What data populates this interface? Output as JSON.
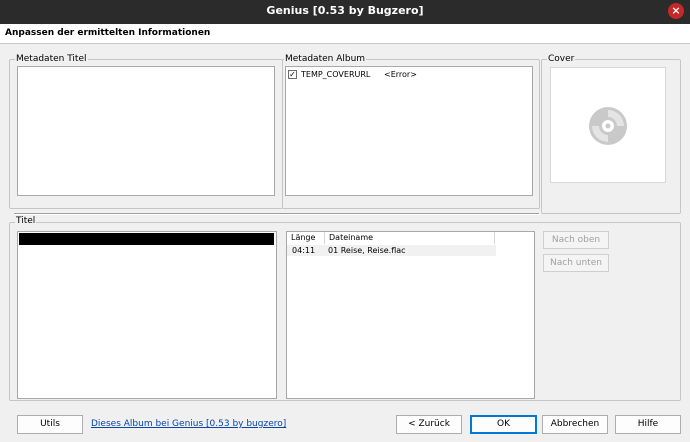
{
  "window": {
    "title": "Genius [0.53 by Bugzero]",
    "close_glyph": "×"
  },
  "header": {
    "text": "Anpassen der ermittelten Informationen"
  },
  "metadata_title": {
    "label": "Metadaten Titel"
  },
  "metadata_album": {
    "label": "Metadaten Album",
    "items": [
      {
        "checked": true,
        "key": "TEMP_COVERURL",
        "value": "<Error>"
      }
    ]
  },
  "cover": {
    "label": "Cover",
    "icon": "disc-icon"
  },
  "titles": {
    "label": "Titel",
    "table": {
      "columns": [
        "Länge",
        "Dateiname"
      ],
      "rows": [
        {
          "length": "04:11",
          "filename": "01 Reise, Reise.flac"
        }
      ]
    },
    "move_up_label": "Nach oben",
    "move_down_label": "Nach unten"
  },
  "footer": {
    "utils_label": "Utils",
    "link_text": "Dieses Album bei Genius [0.53 by bugzero]",
    "back_label": "< Zurück",
    "ok_label": "OK",
    "cancel_label": "Abbrechen",
    "help_label": "Hilfe"
  },
  "colors": {
    "titlebar": "#2b2b2b",
    "close_button": "#c62828",
    "link": "#0645ad",
    "default_button_border": "#0078d7"
  }
}
